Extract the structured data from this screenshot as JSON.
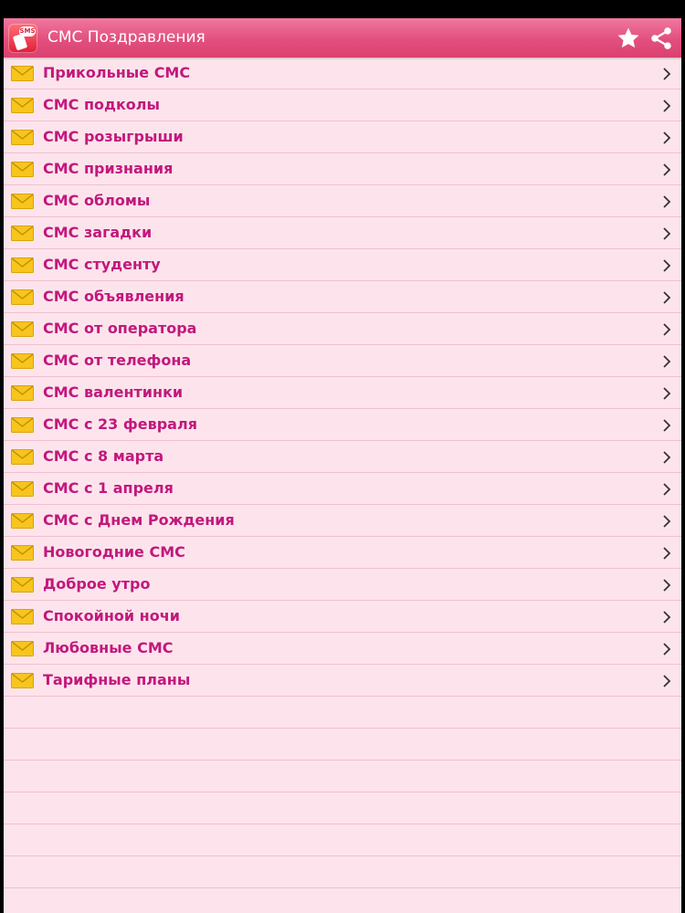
{
  "app": {
    "title": "СМС Поздравления",
    "icon": "sms-app-icon",
    "icon_badge": "SMS"
  },
  "actions": {
    "favorite_icon": "star-icon",
    "share_icon": "share-icon"
  },
  "colors": {
    "actionbar": "#e24f7f",
    "background": "#fde4ec",
    "label": "#c2187c",
    "divider": "#f2bfce",
    "envelope": "#f7c51c"
  },
  "list": {
    "item_icon": "envelope-icon",
    "chevron_icon": "chevron-right-icon",
    "items": [
      {
        "label": "Прикольные СМС"
      },
      {
        "label": "СМС подколы"
      },
      {
        "label": "СМС розыгрыши"
      },
      {
        "label": "СМС признания"
      },
      {
        "label": "СМС обломы"
      },
      {
        "label": "СМС загадки"
      },
      {
        "label": "СМС студенту"
      },
      {
        "label": "СМС объявления"
      },
      {
        "label": "СМС от оператора"
      },
      {
        "label": "СМС от телефона"
      },
      {
        "label": "СМС валентинки"
      },
      {
        "label": "СМС с 23 февраля"
      },
      {
        "label": "СМС с 8 марта"
      },
      {
        "label": "СМС с 1 апреля"
      },
      {
        "label": "СМС с Днем Рождения"
      },
      {
        "label": "Новогодние СМС"
      },
      {
        "label": "Доброе утро"
      },
      {
        "label": "Спокойной ночи"
      },
      {
        "label": "Любовные СМС"
      },
      {
        "label": "Тарифные планы"
      }
    ]
  }
}
